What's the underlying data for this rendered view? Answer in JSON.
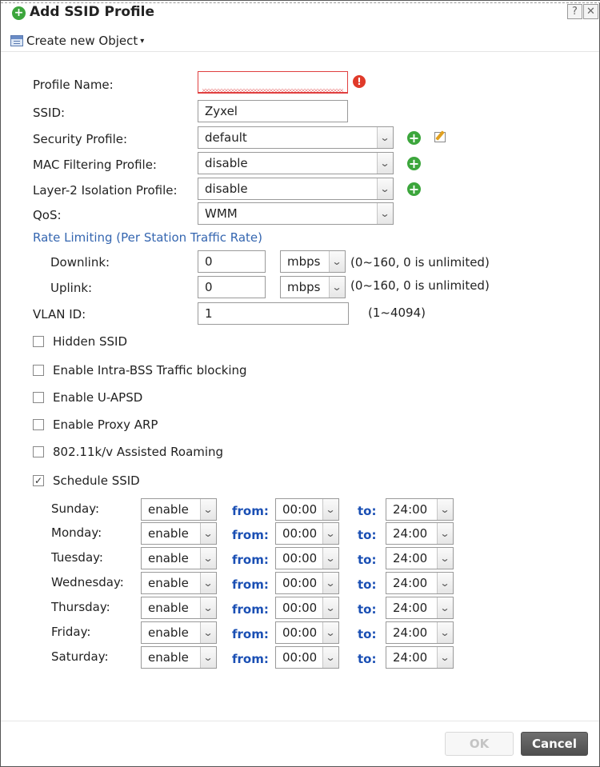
{
  "dialog": {
    "title": "Add SSID Profile",
    "help_label": "?",
    "close_label": "✕"
  },
  "toolbar": {
    "create_label": "Create new Object",
    "caret": "▾"
  },
  "form": {
    "profile_name": {
      "label": "Profile Name:",
      "value": "",
      "error_icon": "!"
    },
    "ssid": {
      "label": "SSID:",
      "value": "Zyxel"
    },
    "security_profile": {
      "label": "Security Profile:",
      "value": "default"
    },
    "mac_filtering_profile": {
      "label": "MAC Filtering Profile:",
      "value": "disable"
    },
    "layer2_isolation_profile": {
      "label": "Layer-2 Isolation Profile:",
      "value": "disable"
    },
    "qos": {
      "label": "QoS:",
      "value": "WMM"
    },
    "rate_limiting": {
      "title": "Rate Limiting (Per Station Traffic Rate)",
      "downlink": {
        "label": "Downlink:",
        "value": "0",
        "unit": "mbps",
        "hint": "(0~160, 0 is unlimited)"
      },
      "uplink": {
        "label": "Uplink:",
        "value": "0",
        "unit": "mbps",
        "hint": "(0~160, 0 is unlimited)"
      }
    },
    "vlan_id": {
      "label": "VLAN ID:",
      "value": "1",
      "hint": "(1~4094)"
    }
  },
  "checkboxes": [
    {
      "label": "Hidden SSID",
      "checked": false
    },
    {
      "label": "Enable Intra-BSS Traffic blocking",
      "checked": false
    },
    {
      "label": "Enable U-APSD",
      "checked": false
    },
    {
      "label": "Enable Proxy ARP",
      "checked": false
    },
    {
      "label": "802.11k/v Assisted Roaming",
      "checked": false
    },
    {
      "label": "Schedule SSID",
      "checked": true
    }
  ],
  "schedule": {
    "from_label": "from:",
    "to_label": "to:",
    "days": [
      {
        "day": "Sunday:",
        "state": "enable",
        "from": "00:00",
        "to": "24:00"
      },
      {
        "day": "Monday:",
        "state": "enable",
        "from": "00:00",
        "to": "24:00"
      },
      {
        "day": "Tuesday:",
        "state": "enable",
        "from": "00:00",
        "to": "24:00"
      },
      {
        "day": "Wednesday:",
        "state": "enable",
        "from": "00:00",
        "to": "24:00"
      },
      {
        "day": "Thursday:",
        "state": "enable",
        "from": "00:00",
        "to": "24:00"
      },
      {
        "day": "Friday:",
        "state": "enable",
        "from": "00:00",
        "to": "24:00"
      },
      {
        "day": "Saturday:",
        "state": "enable",
        "from": "00:00",
        "to": "24:00"
      }
    ]
  },
  "footer": {
    "ok_label": "OK",
    "cancel_label": "Cancel"
  },
  "icons": {
    "plus": "+",
    "check": "✓",
    "dropdown_arrow": "⌄"
  },
  "colors": {
    "accent_green": "#3ca63c",
    "section_blue": "#3566b0",
    "keyword_blue": "#1a4fb4",
    "error_red": "#e03a2a"
  }
}
